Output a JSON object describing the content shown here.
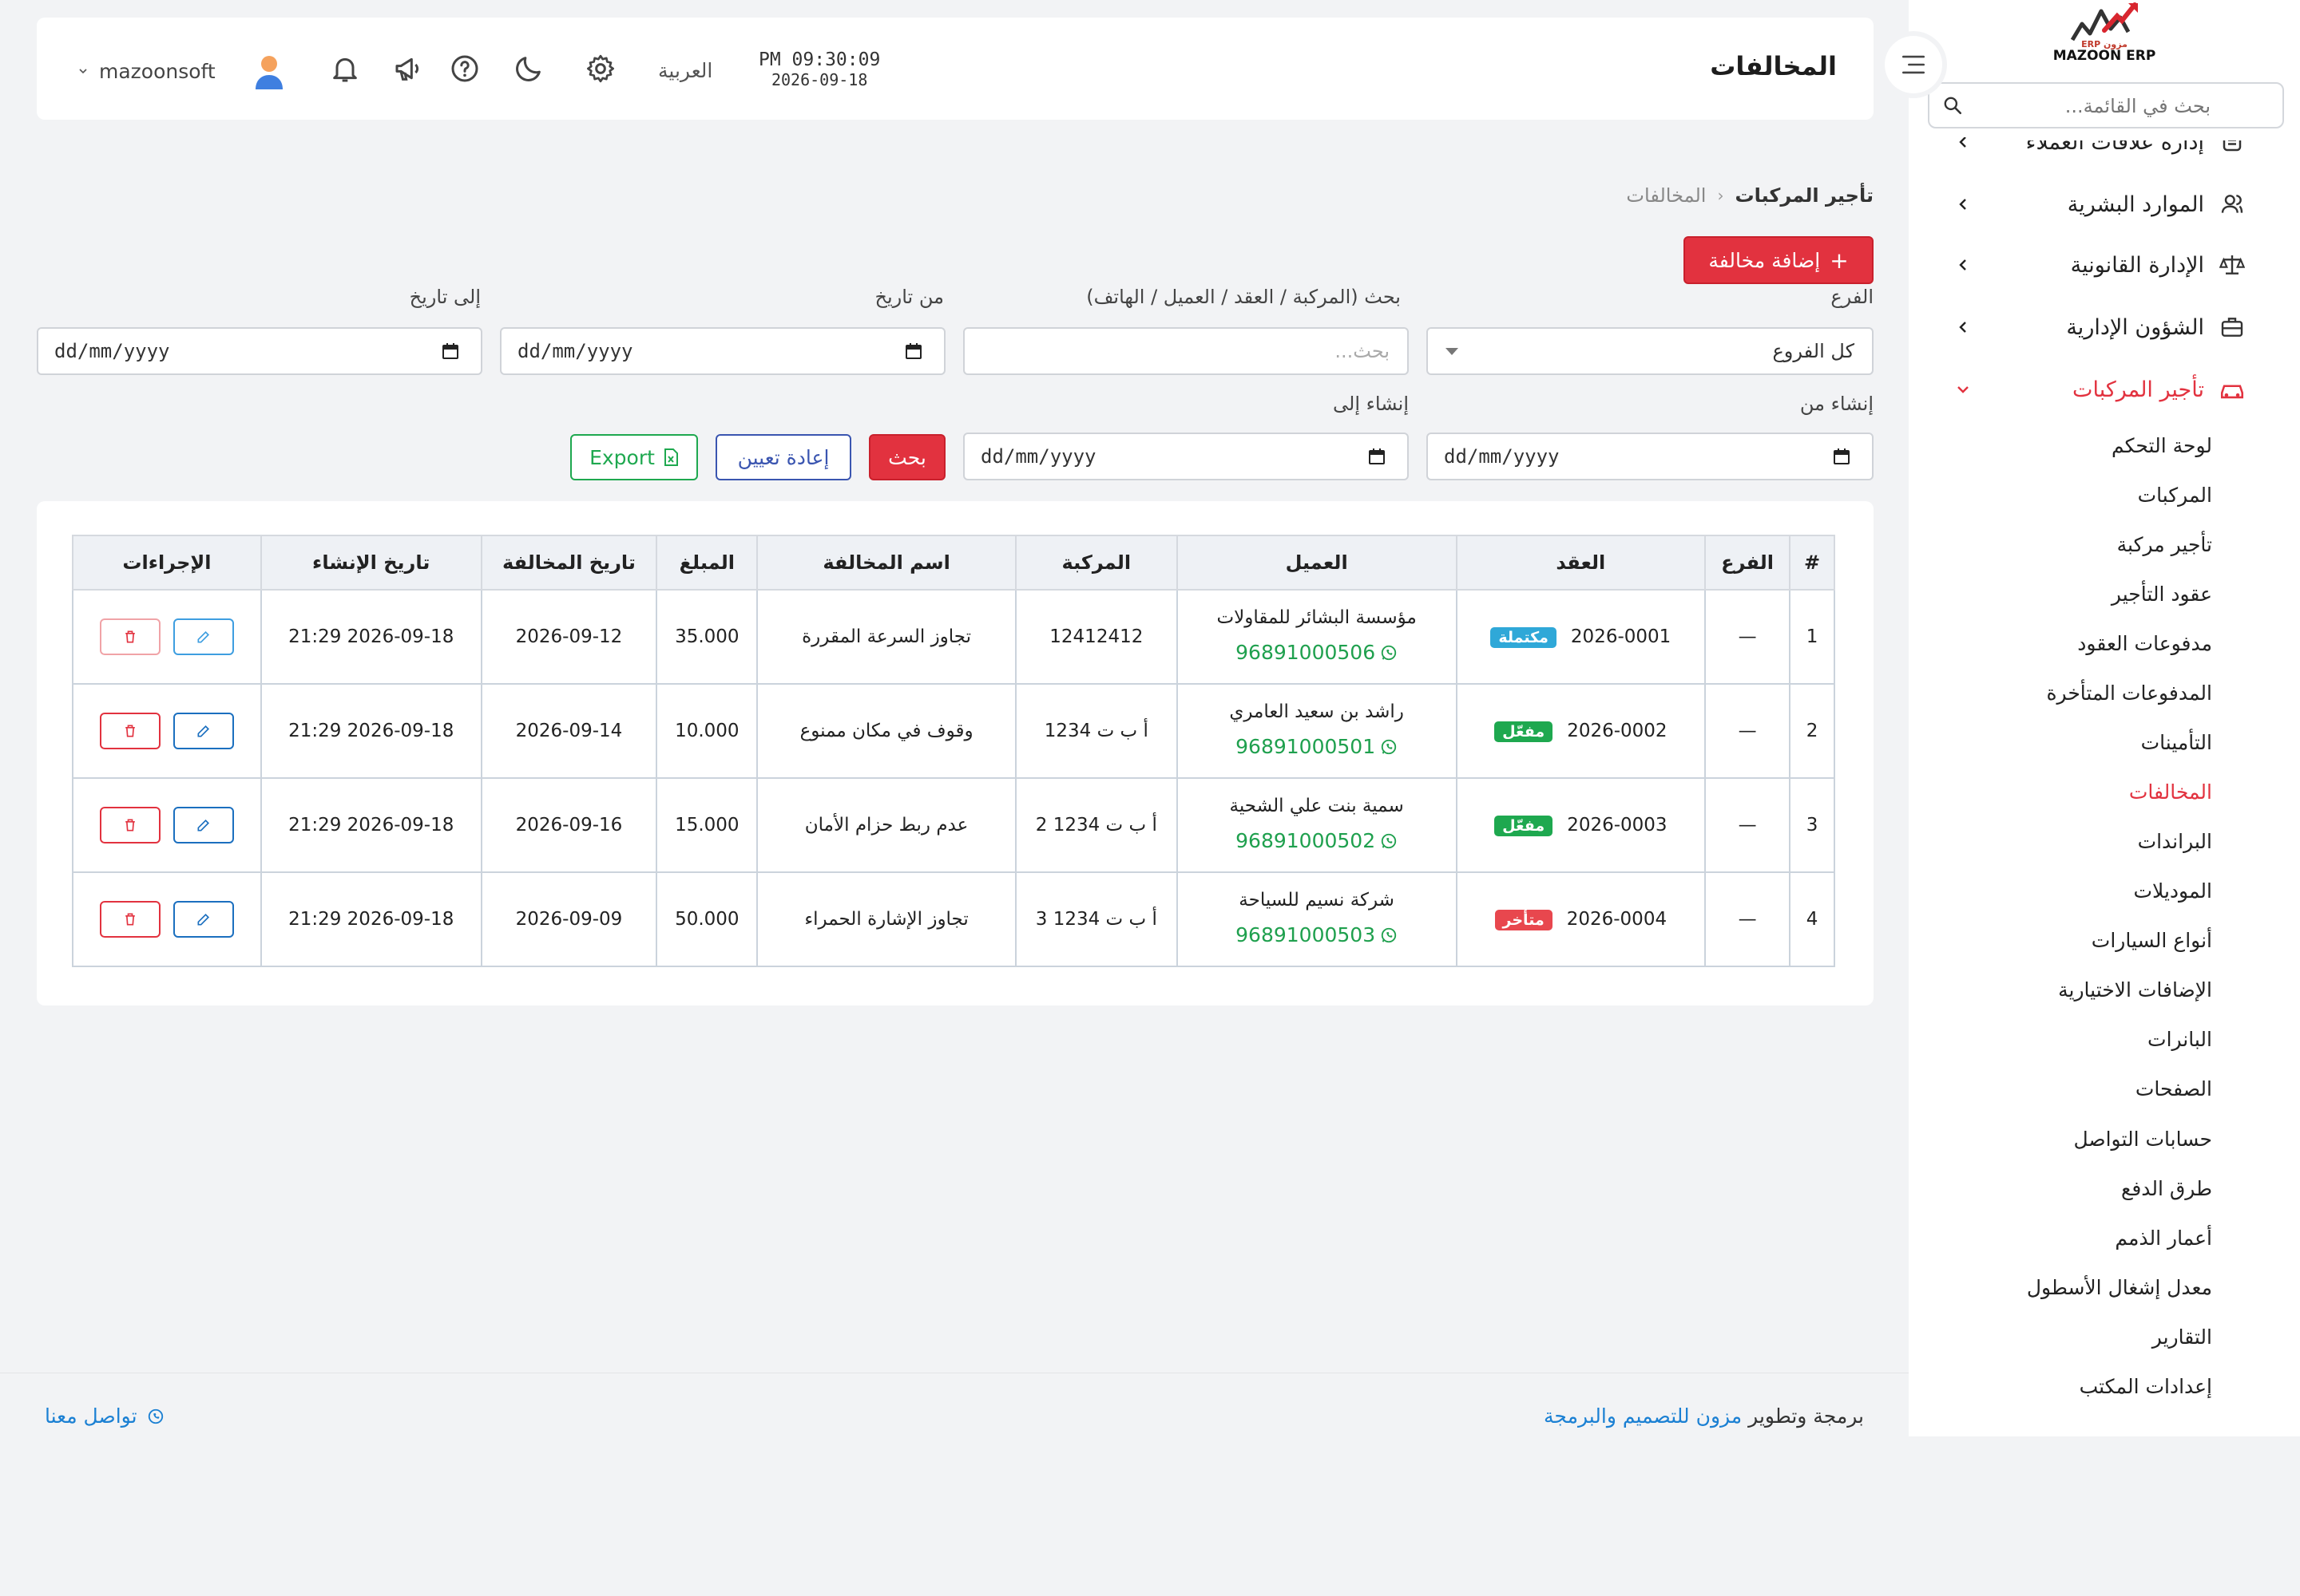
{
  "sidebar": {
    "brand": "MAZOON ERP",
    "brand_small": "ERP مزون",
    "search_placeholder": "بحث في القائمة...",
    "items": [
      {
        "label": "إدارة علاقات العملاء",
        "icon": "crm-icon"
      },
      {
        "label": "الموارد البشرية",
        "icon": "users-icon"
      },
      {
        "label": "الإدارة القانونية",
        "icon": "scale-icon"
      },
      {
        "label": "الشؤون الإدارية",
        "icon": "briefcase-icon"
      },
      {
        "label": "تأجير المركبات",
        "icon": "car-icon"
      }
    ],
    "sub_items": [
      "لوحة التحكم",
      "المركبات",
      "تأجير مركبة",
      "عقود التأجير",
      "مدفوعات العقود",
      "المدفوعات المتأخرة",
      "التأمينات",
      "المخالفات",
      "البراندات",
      "الموديلات",
      "أنواع السيارات",
      "الإضافات الاختيارية",
      "البانرات",
      "الصفحات",
      "حسابات التواصل",
      "طرق الدفع",
      "أعمار الذمم",
      "معدل إشغال الأسطول",
      "التقارير",
      "إعدادات المكتب"
    ],
    "active_sub": "المخالفات"
  },
  "header": {
    "title": "المخالفات",
    "time": "PM 09:30:09",
    "date": "2026-09-18",
    "language": "العربية",
    "username": "mazoonsoft"
  },
  "breadcrumb": {
    "parent": "تأجير المركبات",
    "current": "المخالفات"
  },
  "add_button": "إضافة مخالفة",
  "filters": {
    "branch_label": "الفرع",
    "branch_value": "كل الفروع",
    "search_label": "بحث (المركبة / العقد / العميل / الهاتف)",
    "search_placeholder": "بحث...",
    "from_date_label": "من تاريخ",
    "to_date_label": "إلى تاريخ",
    "created_from_label": "إنشاء من",
    "created_to_label": "إنشاء إلى",
    "date_placeholder": "dd/mm/yyyy",
    "search_btn": "بحث",
    "reset_btn": "إعادة تعيين",
    "export_btn": "Export"
  },
  "table": {
    "headers": [
      "#",
      "الفرع",
      "العقد",
      "العميل",
      "المركبة",
      "اسم المخالفة",
      "المبلغ",
      "تاريخ المخالفة",
      "تاريخ الإنشاء",
      "الإجراءات"
    ],
    "rows": [
      {
        "num": "1",
        "branch": "—",
        "contract": "2026-0001",
        "status": "مكتملة",
        "status_color": "#2fa8d8",
        "customer": "مؤسسة البشائر للمقاولات",
        "phone": "96891000506",
        "vehicle": "12412412",
        "violation": "تجاوز السرعة المقررة",
        "amount": "35.000",
        "violation_date": "2026-09-12",
        "created": "2026-09-18 21:29"
      },
      {
        "num": "2",
        "branch": "—",
        "contract": "2026-0002",
        "status": "مفعّل",
        "status_color": "#1ea84f",
        "customer": "راشد بن سعيد العامري",
        "phone": "96891000501",
        "vehicle": "أ ب ت 1234",
        "violation": "وقوف في مكان ممنوع",
        "amount": "10.000",
        "violation_date": "2026-09-14",
        "created": "2026-09-18 21:29"
      },
      {
        "num": "3",
        "branch": "—",
        "contract": "2026-0003",
        "status": "مفعّل",
        "status_color": "#1ea84f",
        "customer": "سمية بنت علي الشحية",
        "phone": "96891000502",
        "vehicle": "أ ب ت 1234 2",
        "violation": "عدم ربط حزام الأمان",
        "amount": "15.000",
        "violation_date": "2026-09-16",
        "created": "2026-09-18 21:29"
      },
      {
        "num": "4",
        "branch": "—",
        "contract": "2026-0004",
        "status": "متأخر",
        "status_color": "#e8474e",
        "customer": "شركة نسيم للسياحة",
        "phone": "96891000503",
        "vehicle": "أ ب ت 1234 3",
        "violation": "تجاوز الإشارة الحمراء",
        "amount": "50.000",
        "violation_date": "2026-09-09",
        "created": "2026-09-18 21:29"
      }
    ]
  },
  "footer": {
    "prefix": "برمجة وتطوير",
    "link": "مزون للتصميم والبرمجة",
    "contact": "تواصل معنا"
  },
  "colors": {
    "accent": "#e2323f",
    "link": "#1b80d3",
    "whatsapp": "#1fa04e"
  }
}
